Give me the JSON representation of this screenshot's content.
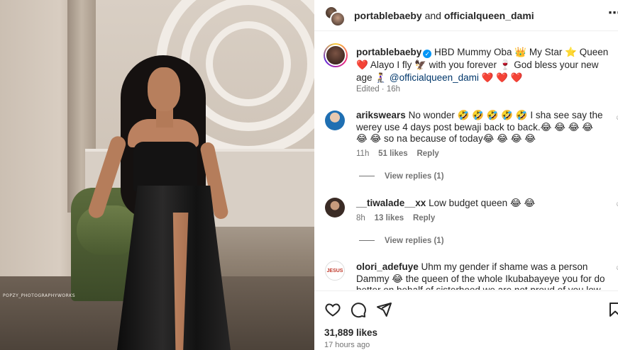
{
  "photo": {
    "watermark": "POPZY_PHOTOGRAPHYWORKS"
  },
  "header": {
    "user1": "portablebaeby",
    "and_text": "and",
    "user2": "officialqueen_dami",
    "more_icon": "more-horizontal-icon"
  },
  "caption": {
    "username": "portablebaeby",
    "text": "HBD Mummy Oba 👑 My Star ⭐ Queen ❤️ Alayo I fly 🦅 with you forever 🍷 God bless your new age 🧎‍♀️",
    "mention": "@officialqueen_dami",
    "hearts": "❤️ ❤️ ❤️",
    "edited": "Edited",
    "age": "16h"
  },
  "comments": [
    {
      "username": "arikswears",
      "text": "No wonder 🤣 🤣 🤣 🤣 🤣 I sha see say the werey use 4 days post bewaji back to back.😂 😂 😂 😂 😂 😂 so na because of today😂 😂 😂 😂",
      "age": "11h",
      "likes": "51 likes",
      "reply": "Reply",
      "view_replies": "View replies (1)",
      "avatar_color": "#1f6fb2"
    },
    {
      "username": "__tiwalade__xx",
      "text": "Low budget queen 😂 😂",
      "age": "8h",
      "likes": "13 likes",
      "reply": "Reply",
      "view_replies": "View replies (1)",
      "avatar_color": "#3a2b25"
    },
    {
      "username": "olori_adefuye",
      "text": "Uhm my gender if shame was a person Dammy 😂 the queen of the whole Ikubabayeye you for do better on behalf of sisterhood we are not proud of you low dignity akoi",
      "avatar_label": "JESUS",
      "avatar_color": "#ffffff"
    }
  ],
  "actions": {
    "like_icon": "heart-icon",
    "comment_icon": "comment-icon",
    "share_icon": "share-icon",
    "save_icon": "bookmark-icon",
    "likes": "31,889 likes",
    "time": "17 hours ago"
  }
}
